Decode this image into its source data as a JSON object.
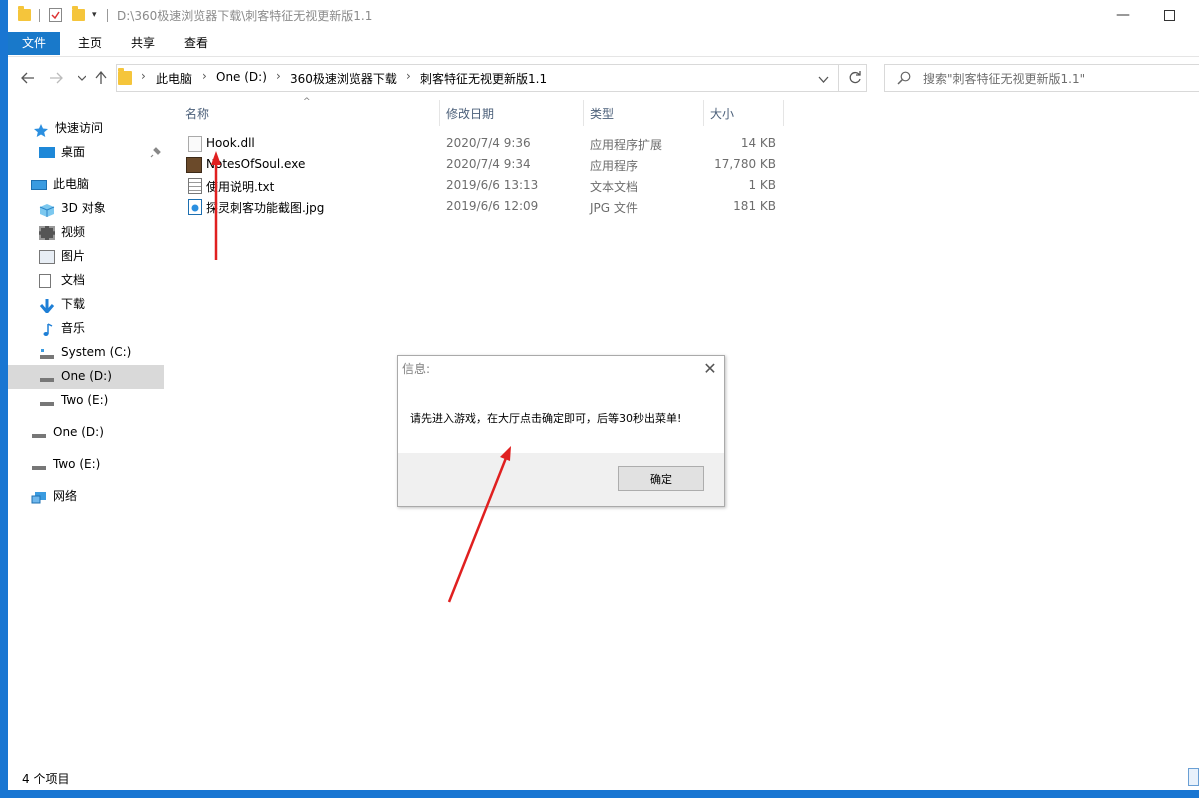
{
  "title_bar": {
    "path": "D:\\360极速浏览器下载\\刺客特征无视更新版1.1"
  },
  "ribbon": {
    "tabs": [
      "文件",
      "主页",
      "共享",
      "查看"
    ]
  },
  "address": {
    "crumbs": [
      "此电脑",
      "One (D:)",
      "360极速浏览器下载",
      "刺客特征无视更新版1.1"
    ]
  },
  "search": {
    "placeholder": "搜索\"刺客特征无视更新版1.1\""
  },
  "nav": {
    "quick_access": "快速访问",
    "desktop": "桌面",
    "this_pc": "此电脑",
    "objects_3d": "3D 对象",
    "videos": "视频",
    "pictures": "图片",
    "documents": "文档",
    "downloads": "下载",
    "music": "音乐",
    "drive_c": "System (C:)",
    "drive_d": "One (D:)",
    "drive_e": "Two (E:)",
    "drive_d2": "One (D:)",
    "drive_e2": "Two (E:)",
    "network": "网络"
  },
  "columns": {
    "name": "名称",
    "date": "修改日期",
    "type": "类型",
    "size": "大小"
  },
  "files": [
    {
      "name": "Hook.dll",
      "date": "2020/7/4 9:36",
      "type": "应用程序扩展",
      "size": "14 KB",
      "icon": "dll-file-icon"
    },
    {
      "name": "NotesOfSoul.exe",
      "date": "2020/7/4 9:34",
      "type": "应用程序",
      "size": "17,780 KB",
      "icon": "exe-app-icon"
    },
    {
      "name": "使用说明.txt",
      "date": "2019/6/6 13:13",
      "type": "文本文档",
      "size": "1 KB",
      "icon": "text-file-icon"
    },
    {
      "name": "探灵刺客功能截图.jpg",
      "date": "2019/6/6 12:09",
      "type": "JPG 文件",
      "size": "181 KB",
      "icon": "image-file-icon"
    }
  ],
  "status": {
    "count": "4 个项目"
  },
  "dialog": {
    "title": "信息:",
    "message": "请先进入游戏，在大厅点击确定即可，后等30秒出菜单!",
    "ok": "确定"
  },
  "colors": {
    "accent": "#1979ca",
    "frame": "#1976d2",
    "annotation_arrow": "#e02020"
  }
}
